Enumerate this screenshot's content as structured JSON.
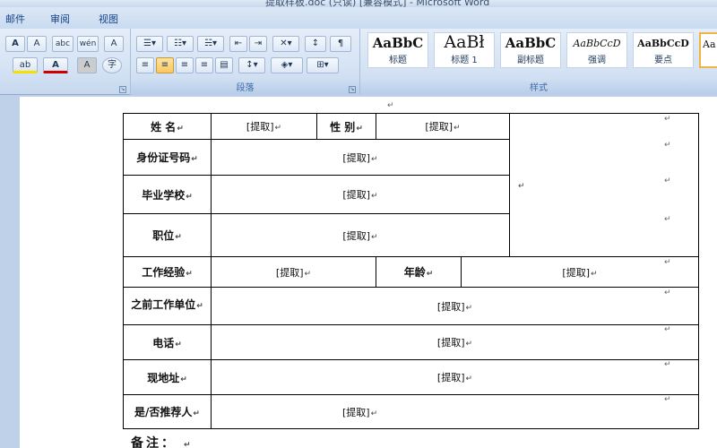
{
  "window": {
    "title": "提取样板.doc (只读) [兼容模式] - Microsoft Word"
  },
  "tabs": [
    "邮件",
    "审阅",
    "视图"
  ],
  "ribbon": {
    "font_buttons": [
      "A",
      "A",
      "abc",
      "wén",
      "A",
      "ab",
      "A",
      "A",
      "字"
    ],
    "paragraph_label": "段落",
    "styles_label": "样式",
    "styles": [
      {
        "sample": "AaBbC",
        "name": "标题"
      },
      {
        "sample": "AaBł",
        "name": "标题 1"
      },
      {
        "sample": "AaBbC",
        "name": "副标题"
      },
      {
        "sample": "AaBbCcD",
        "name": "强调"
      },
      {
        "sample": "AaBbCcD",
        "name": "要点"
      },
      {
        "sample": "Aa",
        "name": ""
      }
    ]
  },
  "form": {
    "name_label": "姓    名",
    "gender_label": "性  别",
    "id_label": "身份证号码",
    "school_label": "毕业学校",
    "position_label": "职位",
    "experience_label": "工作经验",
    "age_label": "年龄",
    "prev_company_label": "之前工作单位",
    "phone_label": "电话",
    "address_label": "现地址",
    "referral_label": "是/否推荐人",
    "placeholder": "[提取]"
  },
  "remark": "备注："
}
